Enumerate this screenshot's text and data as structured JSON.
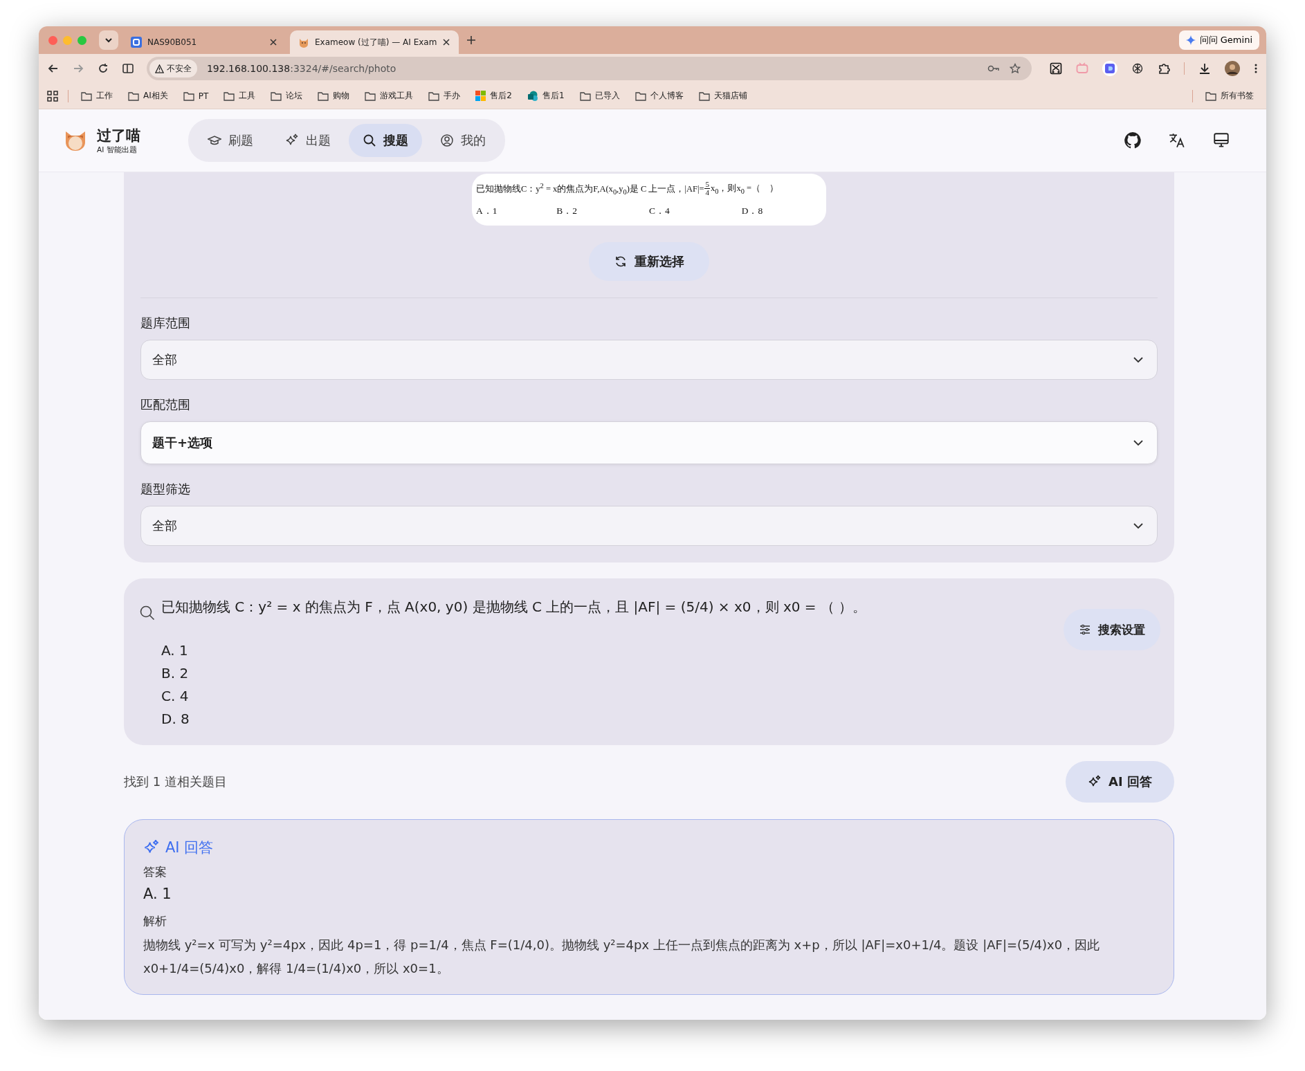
{
  "browser": {
    "tabs": [
      {
        "title": "NAS90B051",
        "selected": false,
        "kind": "q"
      },
      {
        "title": "Exameow (过了喵) — AI Exam",
        "selected": true,
        "kind": "cat"
      }
    ],
    "gemini_button": "问问 Gemini",
    "security_chip": "不安全",
    "url": {
      "host": "192.168.100.138",
      "rest": ":3324/#/search/photo"
    },
    "bookmarks": [
      {
        "label": "工作",
        "kind": "folder"
      },
      {
        "label": "AI相关",
        "kind": "folder"
      },
      {
        "label": "PT",
        "kind": "folder"
      },
      {
        "label": "工具",
        "kind": "folder"
      },
      {
        "label": "论坛",
        "kind": "folder"
      },
      {
        "label": "购物",
        "kind": "folder"
      },
      {
        "label": "游戏工具",
        "kind": "folder"
      },
      {
        "label": "手办",
        "kind": "folder"
      },
      {
        "label": "售后2",
        "kind": "tiles"
      },
      {
        "label": "售后1",
        "kind": "site"
      },
      {
        "label": "已导入",
        "kind": "folder"
      },
      {
        "label": "个人博客",
        "kind": "folder"
      },
      {
        "label": "天猫店铺",
        "kind": "folder"
      }
    ],
    "all_bookmarks": "所有书签"
  },
  "app": {
    "brand": {
      "name": "过了喵",
      "tagline": "AI 智能出题"
    },
    "nav": [
      {
        "label": "刷题",
        "kind": "cap",
        "selected": false
      },
      {
        "label": "出题",
        "kind": "sparkle",
        "selected": false
      },
      {
        "label": "搜题",
        "kind": "search",
        "selected": true
      },
      {
        "label": "我的",
        "kind": "user",
        "selected": false
      }
    ]
  },
  "question_image": {
    "text_before": "已知抛物线C：y$^{2}$ = x的焦点为F,A(x$_{0}$,y$_{0}$)是 C 上一点，|AF|=",
    "numerator": "5",
    "denominator": "4",
    "text_after": "x$_{0}$，则x$_{0}$ =（　）",
    "options": [
      "A．1",
      "B．2",
      "C．4",
      "D．8"
    ]
  },
  "reselect_button": "重新选择",
  "filters": [
    {
      "label": "题库范围",
      "value": "全部",
      "highlighted": false
    },
    {
      "label": "匹配范围",
      "value": "题干+选项",
      "highlighted": true
    },
    {
      "label": "题型筛选",
      "value": "全部",
      "highlighted": false
    }
  ],
  "search": {
    "question": "已知抛物线 C：y² = x 的焦点为 F，点 A(x0, y0) 是抛物线 C 上的一点，且 |AF| = (5/4) × x0，则 x0 = （ ）。",
    "options": [
      "A. 1",
      "B. 2",
      "C. 4",
      "D. 8"
    ],
    "settings_button": "搜索设置"
  },
  "results": {
    "count_text": "找到 1 道相关题目",
    "ai_button": "AI 回答"
  },
  "ai_answer": {
    "title": "AI 回答",
    "answer_label": "答案",
    "answer": "A. 1",
    "analysis_label": "解析",
    "analysis": "抛物线 y²=x 可写为 y²=4px，因此 4p=1，得 p=1/4，焦点 F=(1/4,0)。抛物线 y²=4px 上任一点到焦点的距离为 x+p，所以 |AF|=x0+1/4。题设 |AF|=(5/4)x0，因此 x0+1/4=(5/4)x0，解得 1/4=(1/4)x0，所以 x0=1。"
  }
}
